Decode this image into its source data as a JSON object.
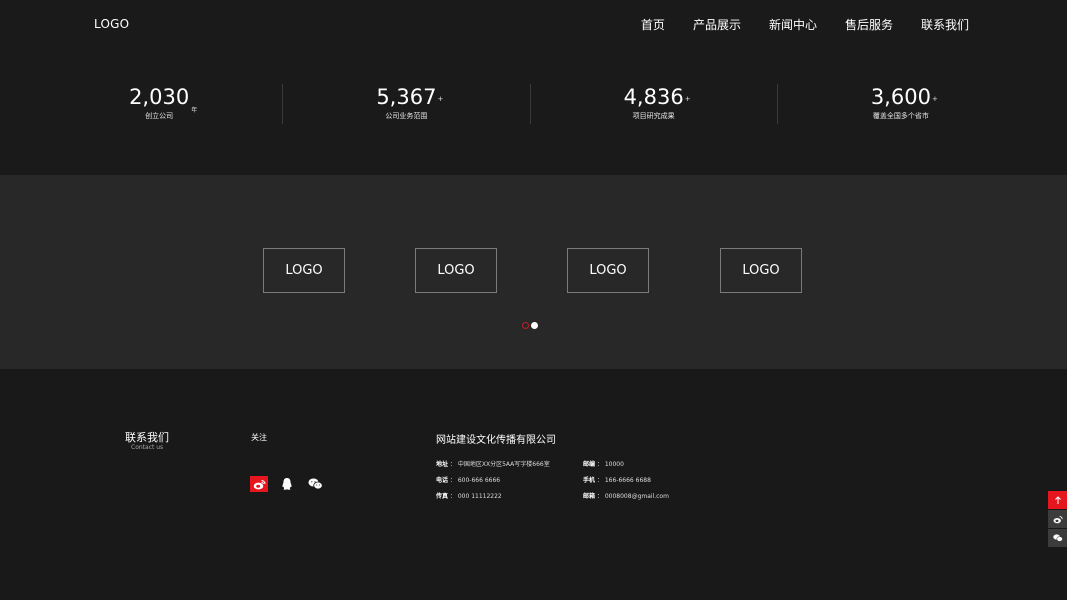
{
  "header": {
    "logo": "LOGO",
    "nav": [
      "首页",
      "产品展示",
      "新闻中心",
      "售后服务",
      "联系我们"
    ]
  },
  "stats": [
    {
      "number": "2,030",
      "unit": "年",
      "sup": "",
      "label": "创立公司"
    },
    {
      "number": "5,367",
      "unit": "",
      "sup": "+",
      "label": "公司业务范围"
    },
    {
      "number": "4,836",
      "unit": "",
      "sup": "+",
      "label": "项目研究成果"
    },
    {
      "number": "3,600",
      "unit": "",
      "sup": "+",
      "label": "覆盖全国多个省市"
    }
  ],
  "partners": {
    "logos": [
      "LOGO",
      "LOGO",
      "LOGO",
      "LOGO"
    ],
    "pagination": {
      "total": 2,
      "active": 1
    }
  },
  "footer": {
    "contact_title": "联系我们",
    "contact_subtitle": "Contact us",
    "follow": "关注",
    "social_icons": [
      "weibo-icon",
      "qq-icon",
      "wechat-icon"
    ],
    "company": "网站建设文化传播有限公司",
    "info": {
      "address_label": "地址",
      "address": "中国地区XX分区5AA写字楼666室",
      "phone_label": "电话",
      "phone": "600-666 6666",
      "fax_label": "传真",
      "fax": "000 11112222",
      "postcode_label": "邮编",
      "postcode": "10000",
      "mobile_label": "手机",
      "mobile": "166-6666 6688",
      "email_label": "邮箱",
      "email": "0008008@gmail.com"
    }
  },
  "sidebar": {
    "icons": [
      "arrow-up-icon",
      "weibo-icon",
      "wechat-icon"
    ]
  },
  "colors": {
    "accent": "#e6161e",
    "background": "#191919",
    "partners_background": "#282828"
  }
}
